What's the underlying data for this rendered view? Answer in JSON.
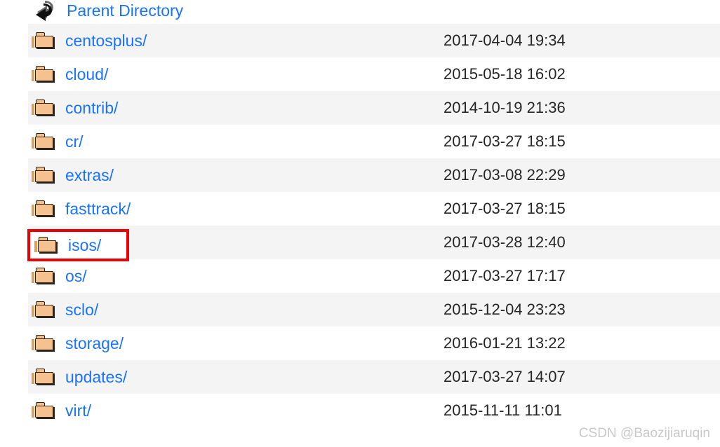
{
  "colors": {
    "link": "#1a73ff",
    "stripe_bg": "#f4f4f4",
    "plain_bg": "#ffffff",
    "date_text": "#262626",
    "highlight_border": "#ef0000",
    "watermark": "#c9c9c9",
    "folder_fill": "#f5c28f",
    "folder_outline": "#2b2218"
  },
  "listing": {
    "parent": {
      "icon": "back-arrow-icon",
      "label": "Parent Directory",
      "date": ""
    },
    "rows": [
      {
        "icon": "folder-icon",
        "name": "centosplus/",
        "date": "2017-04-04 19:34"
      },
      {
        "icon": "folder-icon",
        "name": "cloud/",
        "date": "2015-05-18 16:02"
      },
      {
        "icon": "folder-icon",
        "name": "contrib/",
        "date": "2014-10-19 21:36"
      },
      {
        "icon": "folder-icon",
        "name": "cr/",
        "date": "2017-03-27 18:15"
      },
      {
        "icon": "folder-icon",
        "name": "extras/",
        "date": "2017-03-08 22:29"
      },
      {
        "icon": "folder-icon",
        "name": "fasttrack/",
        "date": "2017-03-27 18:15"
      },
      {
        "icon": "folder-icon",
        "name": "isos/",
        "date": "2017-03-28 12:40"
      },
      {
        "icon": "folder-icon",
        "name": "os/",
        "date": "2017-03-27 17:17"
      },
      {
        "icon": "folder-icon",
        "name": "sclo/",
        "date": "2015-12-04 23:23"
      },
      {
        "icon": "folder-icon",
        "name": "storage/",
        "date": "2016-01-21 13:22"
      },
      {
        "icon": "folder-icon",
        "name": "updates/",
        "date": "2017-03-27 14:07"
      },
      {
        "icon": "folder-icon",
        "name": "virt/",
        "date": "2015-11-11 11:01"
      }
    ]
  },
  "highlight": {
    "target_name": "isos/",
    "icon": "folder-icon"
  },
  "watermark": {
    "text": "CSDN @Baozijiaruqin"
  }
}
